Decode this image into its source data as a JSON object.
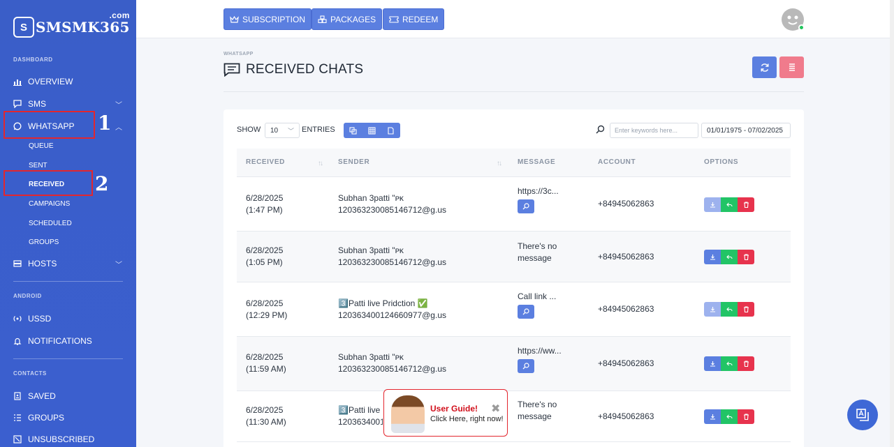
{
  "brand": {
    "logo_letter": "S",
    "name": "SMSMK365",
    "suffix": ".com"
  },
  "sidebar": {
    "sections": {
      "dashboard": "DASHBOARD",
      "android": "ANDROID",
      "contacts": "CONTACTS"
    },
    "items": {
      "overview": "OVERVIEW",
      "sms": "SMS",
      "whatsapp": "WHATSAPP",
      "hosts": "HOSTS",
      "ussd": "USSD",
      "notifications": "NOTIFICATIONS",
      "saved": "SAVED",
      "groups": "GROUPS",
      "unsubscribed": "UNSUBSCRIBED"
    },
    "whatsapp_sub": {
      "queue": "QUEUE",
      "sent": "SENT",
      "received": "RECEIVED",
      "campaigns": "CAMPAIGNS",
      "scheduled": "SCHEDULED",
      "groups": "GROUPS"
    },
    "annotations": {
      "first": "1",
      "second": "2"
    }
  },
  "topbar": {
    "subscription": "SUBSCRIPTION",
    "packages": "PACKAGES",
    "redeem": "REDEEM"
  },
  "page": {
    "breadcrumb": "WHATSAPP",
    "title": "RECEIVED CHATS"
  },
  "table_controls": {
    "show_label": "SHOW",
    "entries_value": "10",
    "entries_label": "ENTRIES",
    "search_placeholder": "Enter keywords here...",
    "date_range": "01/01/1975 - 07/02/2025"
  },
  "table": {
    "headers": {
      "received": "RECEIVED",
      "sender": "SENDER",
      "message": "MESSAGE",
      "account": "ACCOUNT",
      "options": "OPTIONS"
    },
    "rows": [
      {
        "date": "6/28/2025",
        "time": "(1:47 PM)",
        "sender_name": "Subhan 3patti \"ᴘᴋ",
        "sender_id": "120363230085146712@g.us",
        "message": "https://3c...",
        "account": "+84945062863"
      },
      {
        "date": "6/28/2025",
        "time": "(1:05 PM)",
        "sender_name": "Subhan 3patti \"ᴘᴋ",
        "sender_id": "120363230085146712@g.us",
        "message": "There's no message",
        "account": "+84945062863"
      },
      {
        "date": "6/28/2025",
        "time": "(12:29 PM)",
        "sender_name": "3️⃣Patti live Pridction ✅",
        "sender_id": "120363400124660977@g.us",
        "message": "Call link ...",
        "account": "+84945062863"
      },
      {
        "date": "6/28/2025",
        "time": "(11:59 AM)",
        "sender_name": "Subhan 3patti \"ᴘᴋ",
        "sender_id": "120363230085146712@g.us",
        "message": "https://ww...",
        "account": "+84945062863"
      },
      {
        "date": "6/28/2025",
        "time": "(11:30 AM)",
        "sender_name": "3️⃣Patti live Pridction ✅",
        "sender_id": "120363400124660977@g.us",
        "message": "There's no message",
        "account": "+84945062863"
      }
    ]
  },
  "guide": {
    "title": "User Guide!",
    "subtitle": "Click Here, right now!"
  },
  "colors": {
    "primary": "#5b7fe0",
    "sidebar": "#3b5fcf",
    "success": "#22c466",
    "danger": "#e7334d",
    "annotation_red": "#e3262e"
  }
}
